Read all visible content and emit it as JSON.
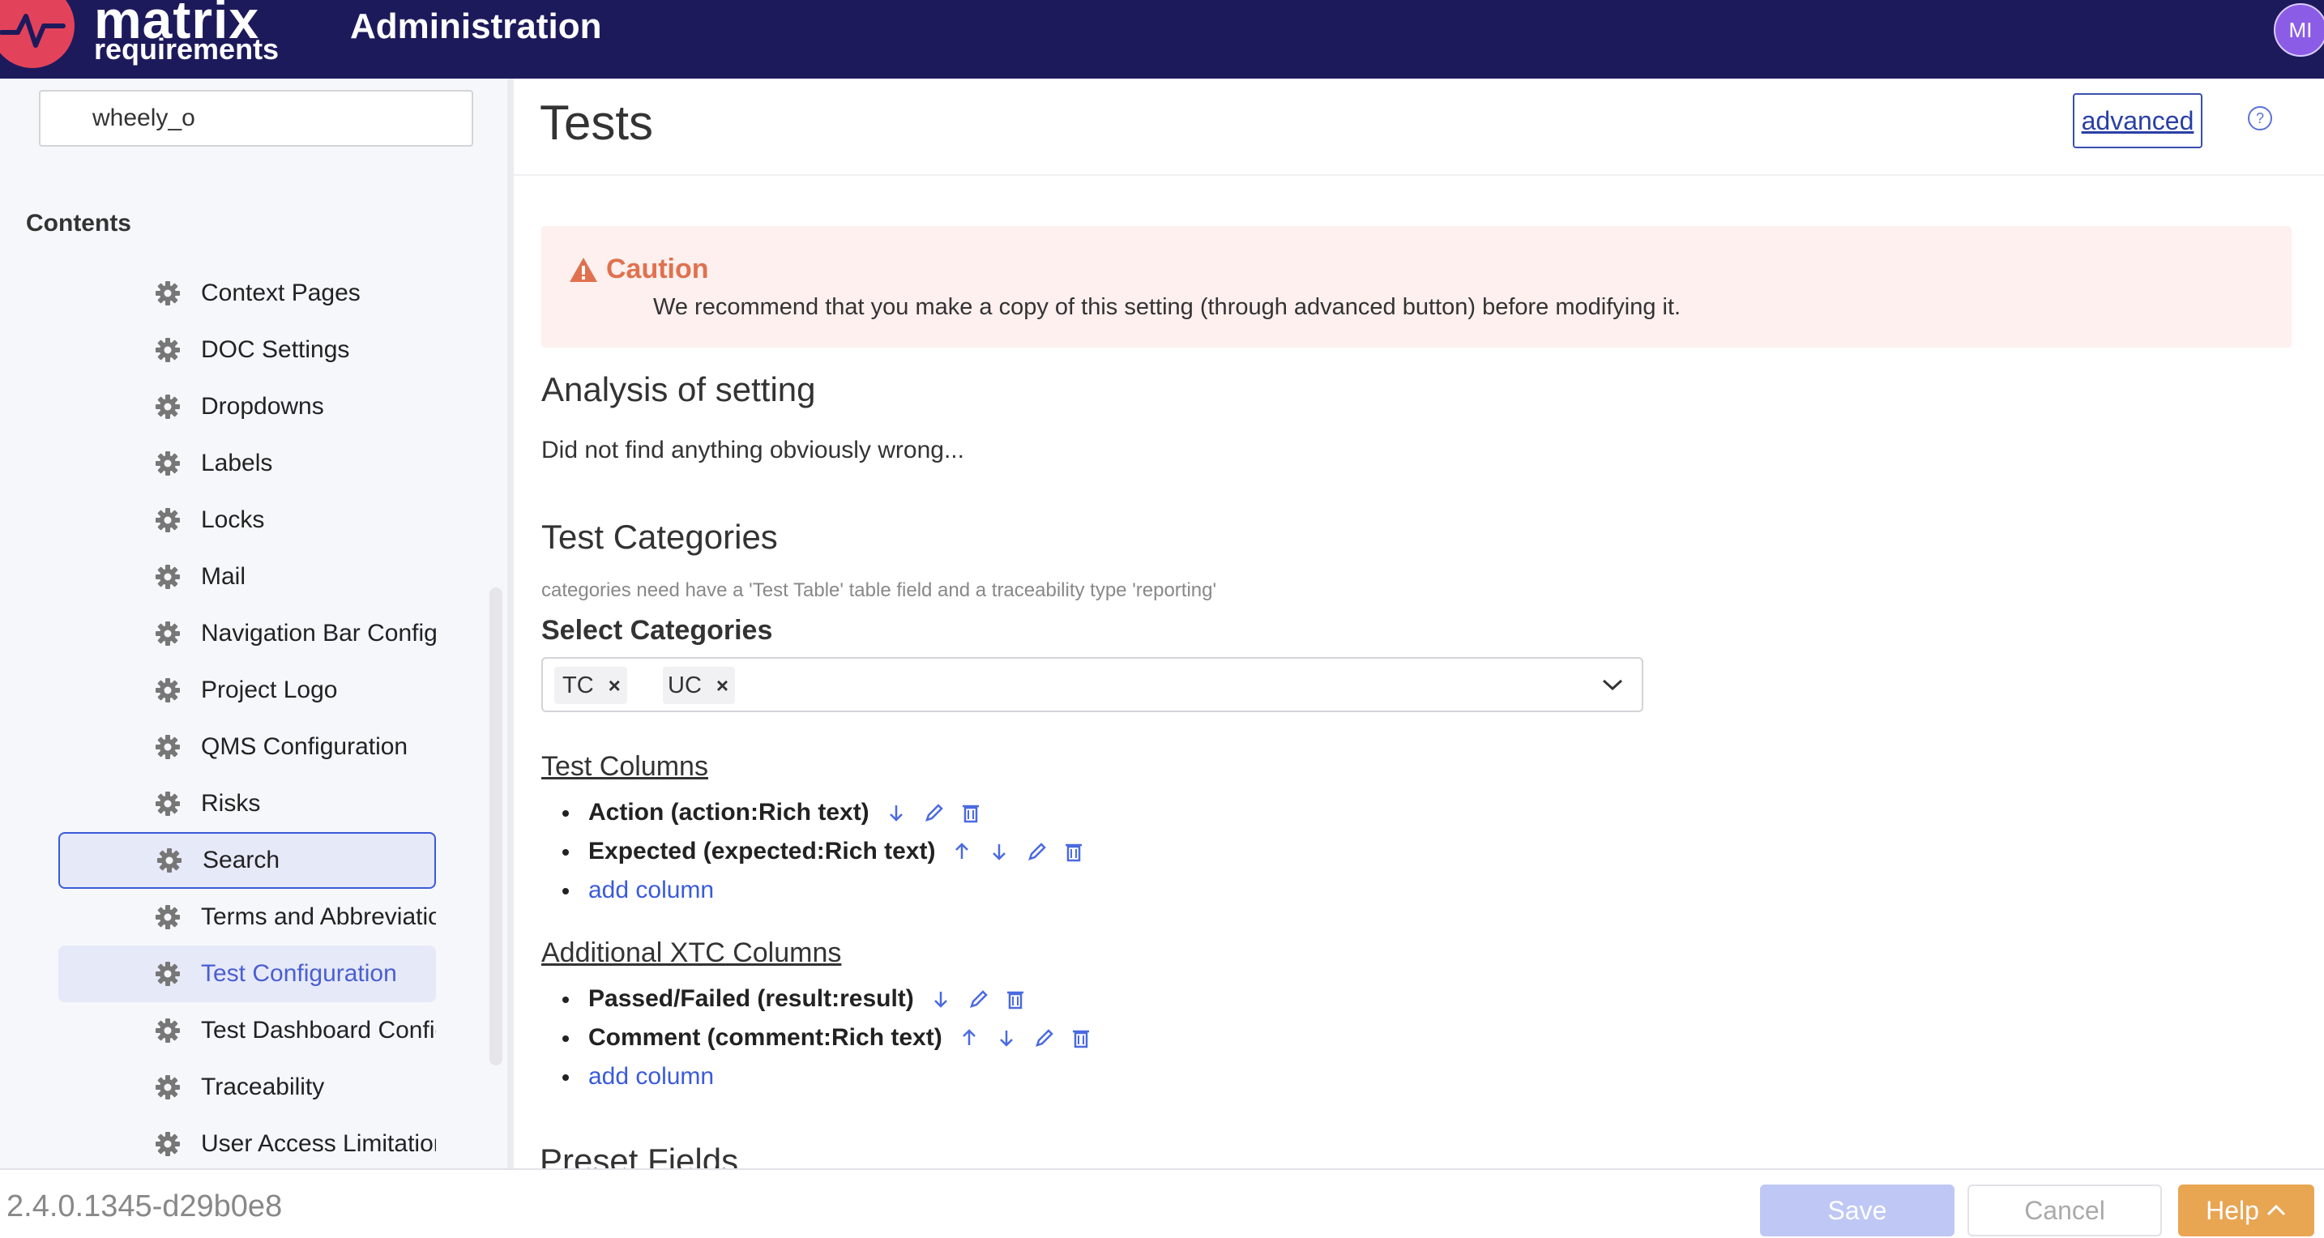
{
  "header": {
    "logo_line1": "matrix",
    "logo_line2": "requirements",
    "title": "Administration",
    "avatar_initials": "MI"
  },
  "sidebar": {
    "search_value": "wheely_o",
    "contents_label": "Contents",
    "items": [
      {
        "label": "Context Pages",
        "state": "normal"
      },
      {
        "label": "DOC Settings",
        "state": "normal"
      },
      {
        "label": "Dropdowns",
        "state": "normal"
      },
      {
        "label": "Labels",
        "state": "normal"
      },
      {
        "label": "Locks",
        "state": "normal"
      },
      {
        "label": "Mail",
        "state": "normal"
      },
      {
        "label": "Navigation Bar Configurati",
        "state": "normal"
      },
      {
        "label": "Project Logo",
        "state": "normal"
      },
      {
        "label": "QMS Configuration",
        "state": "normal"
      },
      {
        "label": "Risks",
        "state": "normal"
      },
      {
        "label": "Search",
        "state": "focused"
      },
      {
        "label": "Terms and Abbreviations",
        "state": "normal"
      },
      {
        "label": "Test Configuration",
        "state": "active"
      },
      {
        "label": "Test Dashboard Configura",
        "state": "normal"
      },
      {
        "label": "Traceability",
        "state": "normal"
      },
      {
        "label": "User Access Limitations",
        "state": "normal"
      }
    ]
  },
  "main": {
    "page_title": "Tests",
    "advanced_label": "advanced",
    "help_icon": "question-circle-icon",
    "caution": {
      "title": "Caution",
      "text": "We recommend that you make a copy of this setting (through advanced button) before modifying it."
    },
    "analysis": {
      "heading": "Analysis of setting",
      "text": "Did not find anything obviously wrong..."
    },
    "categories": {
      "heading": "Test Categories",
      "hint": "categories need have a 'Test Table' table field and a traceability type 'reporting'",
      "select_label": "Select Categories",
      "chips": [
        "TC",
        "UC"
      ],
      "chip_remove": "×"
    },
    "test_columns": {
      "heading": "Test Columns",
      "items": [
        "Action (action:Rich text)",
        "Expected (expected:Rich text)"
      ],
      "add_label": "add column"
    },
    "xtc_columns": {
      "heading": "Additional XTC Columns",
      "items": [
        "Passed/Failed (result:result)",
        "Comment (comment:Rich text)"
      ],
      "add_label": "add column"
    },
    "preset_heading": "Preset Fields"
  },
  "footer": {
    "version": "2.4.0.1345-d29b0e8",
    "save_label": "Save",
    "cancel_label": "Cancel",
    "help_label": "Help"
  },
  "colors": {
    "topbar": "#1d1a5c",
    "accent": "#3a5bd9",
    "caution": "#e0714f",
    "help_button": "#e8a552"
  }
}
